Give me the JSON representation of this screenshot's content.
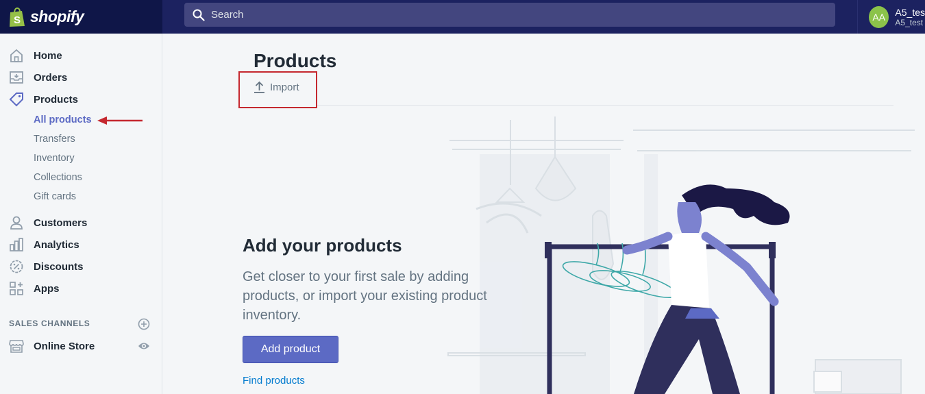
{
  "header": {
    "brand": "shopify",
    "search_placeholder": "Search",
    "account": {
      "initials": "AA",
      "name": "A5_tes",
      "store": "A5_test"
    }
  },
  "sidebar": {
    "items": [
      {
        "label": "Home"
      },
      {
        "label": "Orders"
      },
      {
        "label": "Products"
      },
      {
        "label": "Customers"
      },
      {
        "label": "Analytics"
      },
      {
        "label": "Discounts"
      },
      {
        "label": "Apps"
      }
    ],
    "product_subitems": [
      "All products",
      "Transfers",
      "Inventory",
      "Collections",
      "Gift cards"
    ],
    "sales_channels_label": "SALES CHANNELS",
    "online_store_label": "Online Store"
  },
  "main": {
    "title": "Products",
    "import_label": "Import",
    "empty_state": {
      "title": "Add your products",
      "description": "Get closer to your first sale by adding products, or import your existing product inventory.",
      "add_button": "Add product",
      "find_link": "Find products"
    }
  },
  "colors": {
    "primary": "#5c6ac4",
    "topbar": "#1c2260",
    "link": "#007ace",
    "annotation": "#c5282f"
  }
}
